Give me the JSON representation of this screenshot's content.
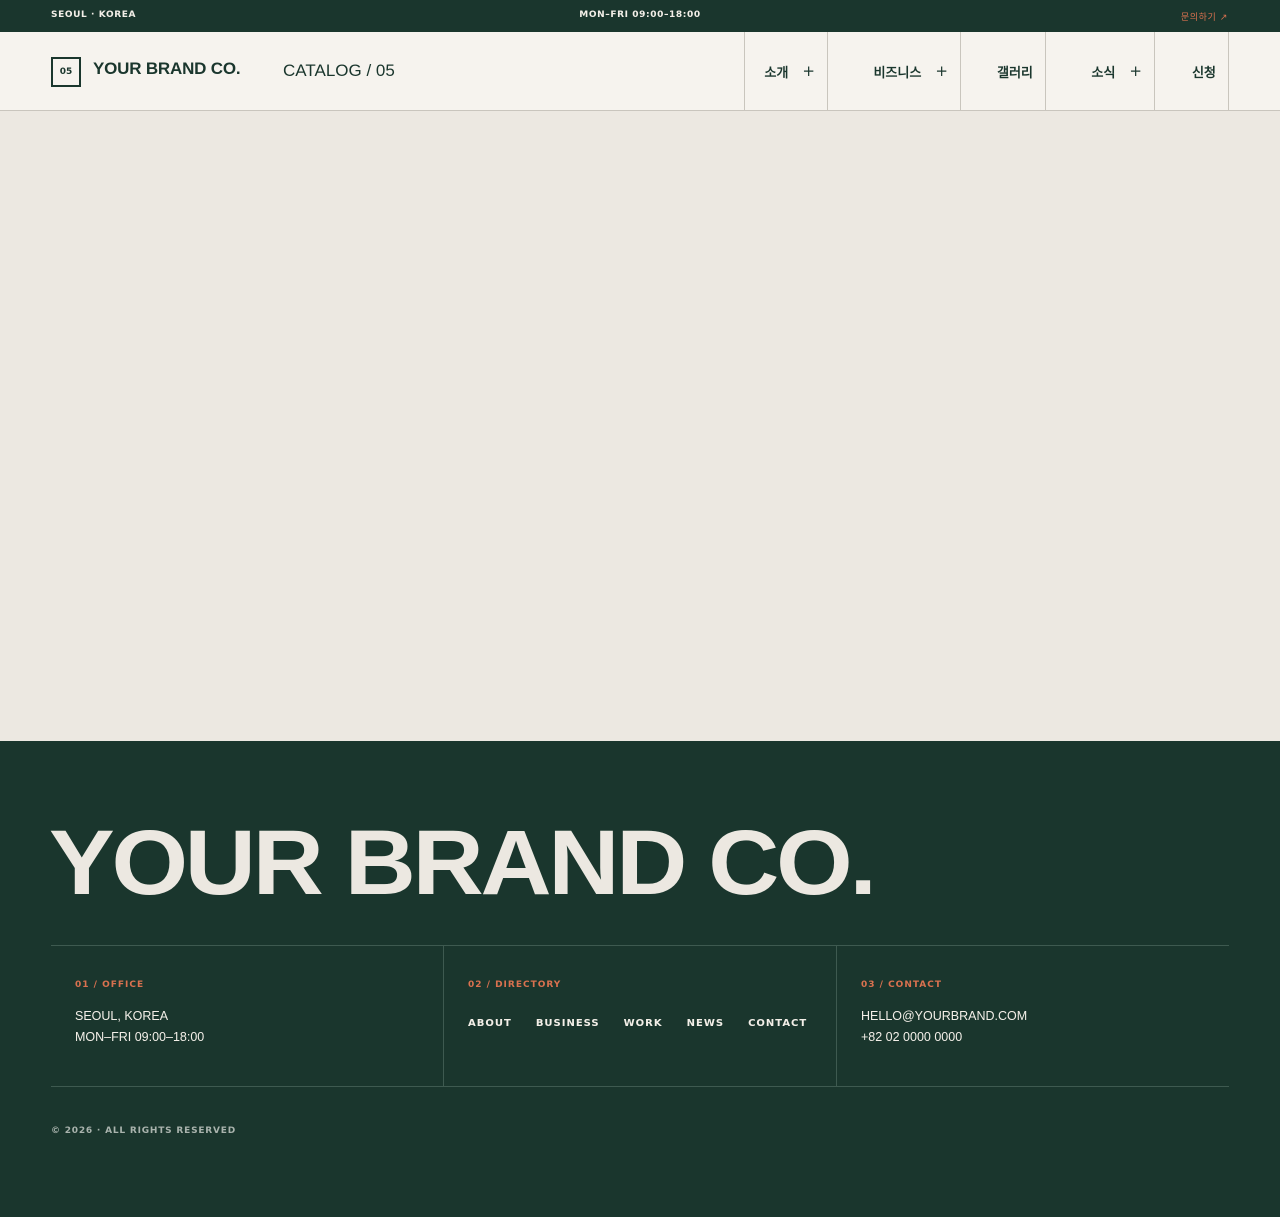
{
  "topbar": {
    "location": "SEOUL · KOREA",
    "hours": "MON–FRI 09:00–18:00",
    "inquiry": "문의하기 ↗"
  },
  "header": {
    "logo_number": "05",
    "brand": "YOUR BRAND CO.",
    "catalog": "CATALOG / 05",
    "nav": [
      {
        "label": "소개",
        "plus": "+"
      },
      {
        "label": "비즈니스",
        "plus": "+"
      },
      {
        "label": "갤러리"
      },
      {
        "label": "소식",
        "plus": "+"
      },
      {
        "label": "신청"
      }
    ]
  },
  "footer": {
    "brand": "YOUR BRAND CO.",
    "office": {
      "title": "01 / OFFICE",
      "line1": "SEOUL, KOREA",
      "line2": "MON–FRI 09:00–18:00"
    },
    "directory": {
      "title": "02 / DIRECTORY",
      "links": [
        "ABOUT",
        "BUSINESS",
        "WORK",
        "NEWS",
        "CONTACT"
      ]
    },
    "contact": {
      "title": "03 / CONTACT",
      "email": "HELLO@YOURBRAND.COM",
      "phone": "+82 02 0000 0000"
    },
    "copyright": "© 2026 · ALL RIGHTS RESERVED"
  },
  "colors": {
    "primary": "#1a362d",
    "accent": "#d9714f",
    "background": "#ece8e1",
    "header_bg": "#f6f3ee"
  }
}
